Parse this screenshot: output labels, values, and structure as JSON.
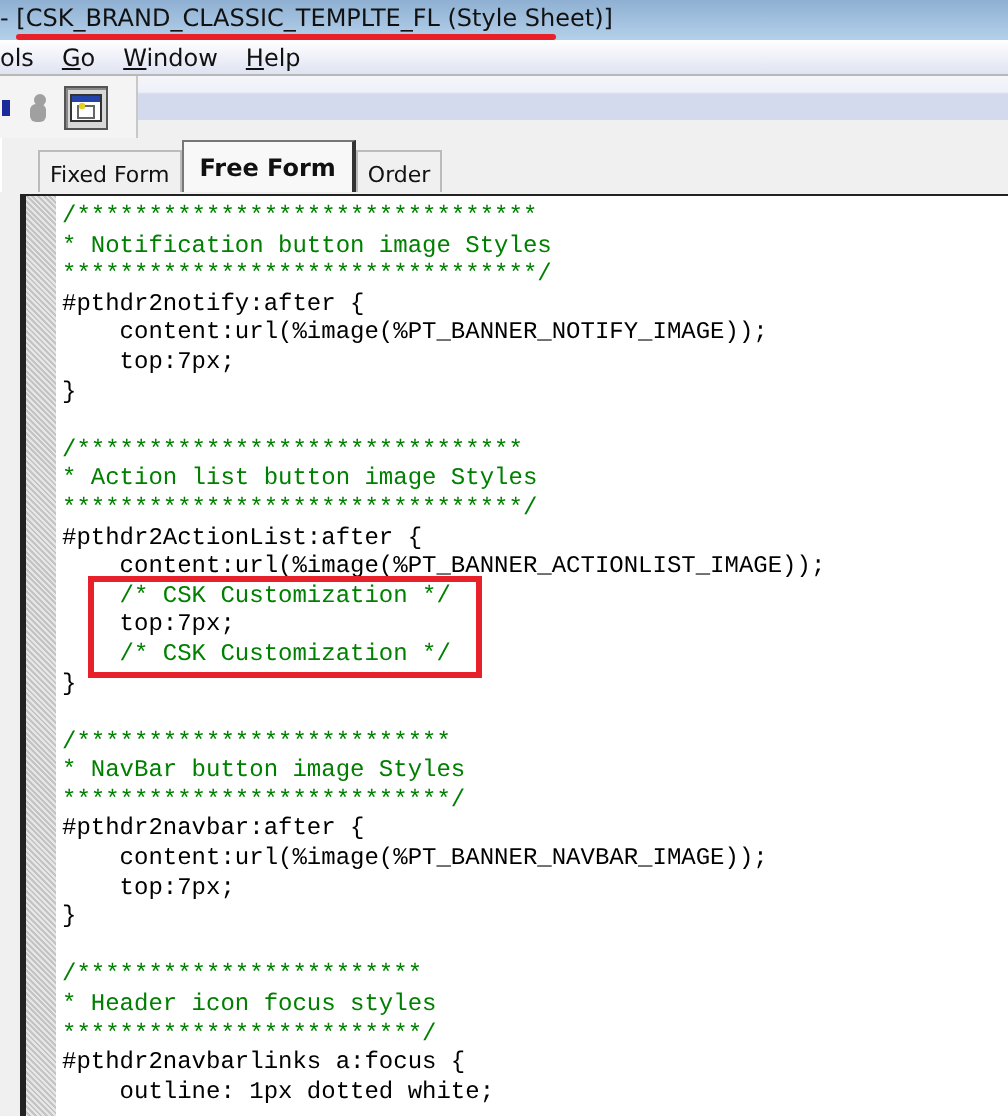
{
  "window": {
    "title": "- [CSK_BRAND_CLASSIC_TEMPLTE_FL (Style Sheet)]"
  },
  "menu": [
    {
      "rest": "ols"
    },
    {
      "key": "G",
      "rest": "o"
    },
    {
      "key": "W",
      "rest": "indow"
    },
    {
      "key": "H",
      "rest": "elp"
    }
  ],
  "toolbar": [
    {
      "kind": "partial",
      "pressed": false
    },
    {
      "kind": "figure",
      "pressed": false
    },
    {
      "kind": "window",
      "pressed": true
    }
  ],
  "tabs": [
    {
      "label": "Fixed Form",
      "selected": false
    },
    {
      "label": "Free Form",
      "selected": true
    },
    {
      "label": "Order",
      "selected": false
    }
  ],
  "editor": {
    "lines": [
      {
        "kind": "comment",
        "text": "/********************************"
      },
      {
        "kind": "comment",
        "text": "* Notification button image Styles"
      },
      {
        "kind": "comment",
        "text": "*********************************/"
      },
      {
        "kind": "code",
        "text": "#pthdr2notify:after {"
      },
      {
        "kind": "code",
        "text": "    content:url(%image(%PT_BANNER_NOTIFY_IMAGE));"
      },
      {
        "kind": "code",
        "text": "    top:7px;"
      },
      {
        "kind": "code",
        "text": "}"
      },
      {
        "kind": "blank"
      },
      {
        "kind": "comment",
        "text": "/*******************************"
      },
      {
        "kind": "comment",
        "text": "* Action list button image Styles"
      },
      {
        "kind": "comment",
        "text": "********************************/"
      },
      {
        "kind": "code",
        "text": "#pthdr2ActionList:after {"
      },
      {
        "kind": "code",
        "text": "    content:url(%image(%PT_BANNER_ACTIONLIST_IMAGE));"
      },
      {
        "kind": "comment",
        "text": "    /* CSK Customization */",
        "highlight": true
      },
      {
        "kind": "code",
        "text": "    top:7px;",
        "highlight": true
      },
      {
        "kind": "comment",
        "text": "    /* CSK Customization */",
        "highlight": true
      },
      {
        "kind": "code",
        "text": "}"
      },
      {
        "kind": "blank"
      },
      {
        "kind": "comment",
        "text": "/**************************"
      },
      {
        "kind": "comment",
        "text": "* NavBar button image Styles"
      },
      {
        "kind": "comment",
        "text": "***************************/"
      },
      {
        "kind": "code",
        "text": "#pthdr2navbar:after {"
      },
      {
        "kind": "code",
        "text": "    content:url(%image(%PT_BANNER_NAVBAR_IMAGE));"
      },
      {
        "kind": "code",
        "text": "    top:7px;"
      },
      {
        "kind": "code",
        "text": "}"
      },
      {
        "kind": "blank"
      },
      {
        "kind": "comment",
        "text": "/************************"
      },
      {
        "kind": "comment",
        "text": "* Header icon focus styles"
      },
      {
        "kind": "comment",
        "text": "*************************/"
      },
      {
        "kind": "code",
        "text": "#pthdr2navbarlinks a:focus {"
      },
      {
        "kind": "code",
        "text": "    outline: 1px dotted white;"
      }
    ]
  }
}
